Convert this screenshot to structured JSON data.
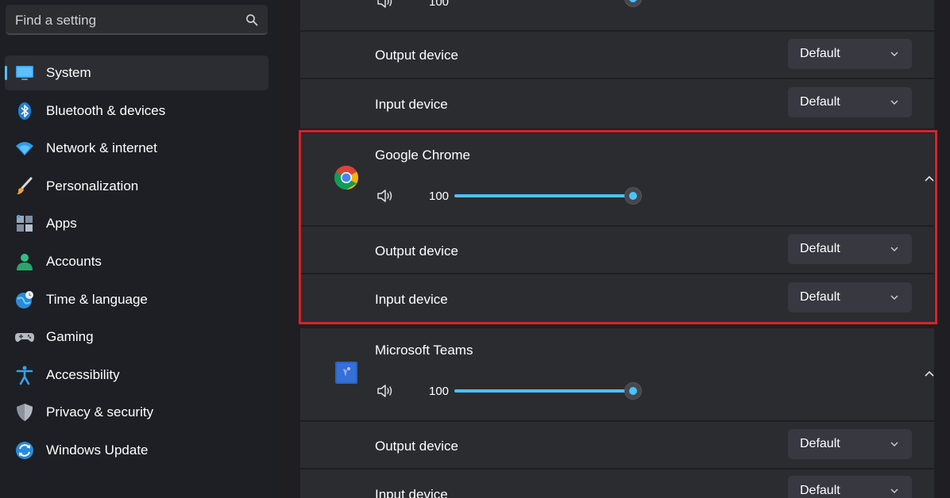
{
  "search": {
    "placeholder": "Find a setting",
    "icon": "search-icon"
  },
  "sidebar": {
    "selected_color": "#4cc2ff",
    "items": [
      {
        "label": "System",
        "icon": "monitor-icon",
        "selected": true
      },
      {
        "label": "Bluetooth & devices",
        "icon": "bluetooth-icon"
      },
      {
        "label": "Network & internet",
        "icon": "wifi-icon"
      },
      {
        "label": "Personalization",
        "icon": "brush-icon"
      },
      {
        "label": "Apps",
        "icon": "apps-icon"
      },
      {
        "label": "Accounts",
        "icon": "person-icon"
      },
      {
        "label": "Time & language",
        "icon": "globe-clock-icon"
      },
      {
        "label": "Gaming",
        "icon": "gamepad-icon"
      },
      {
        "label": "Accessibility",
        "icon": "accessibility-icon"
      },
      {
        "label": "Privacy & security",
        "icon": "shield-icon"
      },
      {
        "label": "Windows Update",
        "icon": "update-icon"
      }
    ]
  },
  "top_app": {
    "volume": "100",
    "output_label": "Output device",
    "output_value": "Default",
    "input_label": "Input device",
    "input_value": "Default"
  },
  "apps": [
    {
      "name": "Google Chrome",
      "icon": "chrome-icon",
      "volume": "100",
      "output_label": "Output device",
      "output_value": "Default",
      "input_label": "Input device",
      "input_value": "Default"
    },
    {
      "name": "Microsoft Teams",
      "icon": "teams-icon",
      "volume": "100",
      "output_label": "Output device",
      "output_value": "Default",
      "input_label": "Input device",
      "input_value": "Default"
    }
  ],
  "highlight_color": "#d8232a",
  "accent_color": "#4cc2ff"
}
